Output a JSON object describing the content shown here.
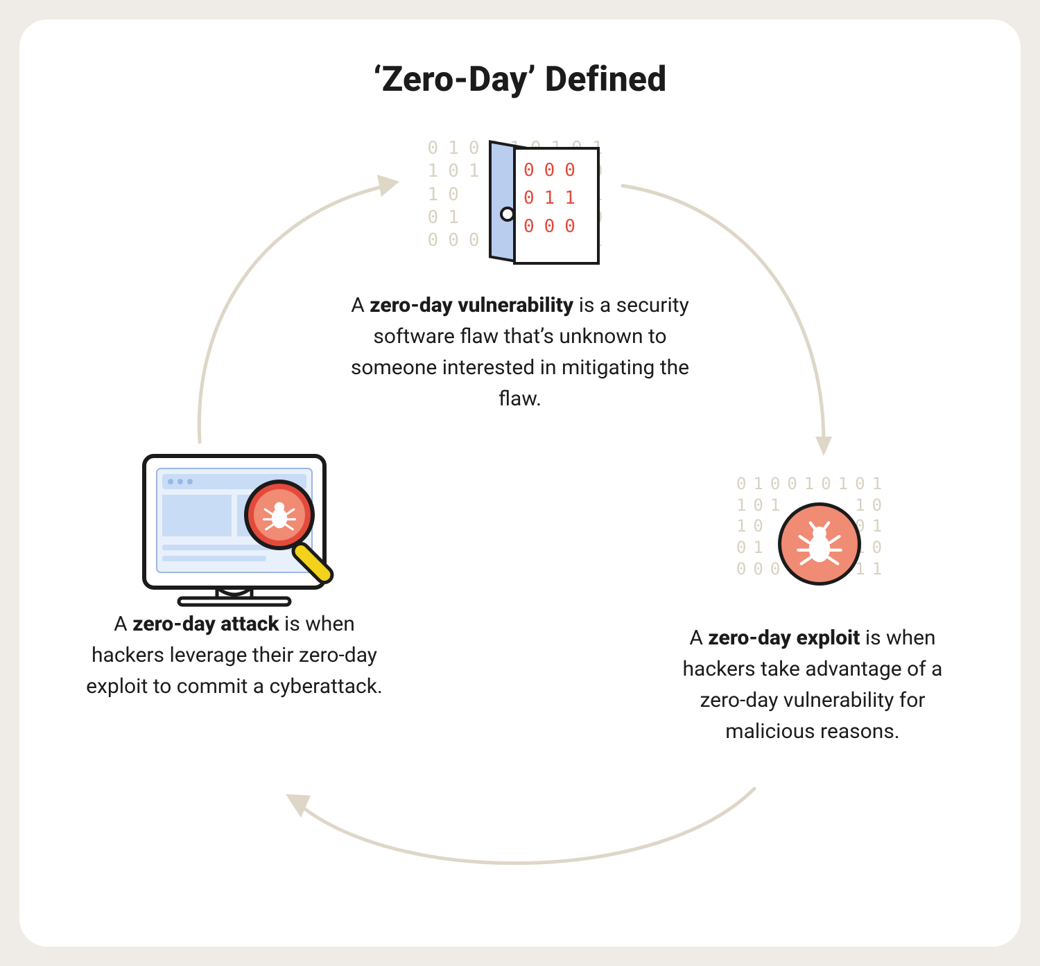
{
  "title": "‘Zero-Day’ Defined",
  "nodes": {
    "top": {
      "pre": "A ",
      "bold": "zero-day vulnerability",
      "post": " is a security software flaw that’s unknown to someone interested in mitigating the flaw."
    },
    "right": {
      "pre": "A ",
      "bold": "zero-day exploit",
      "post": " is when hackers take advantage of a zero-day vulnerability for malicious reasons."
    },
    "left": {
      "pre": "A ",
      "bold": "zero-day attack",
      "post": " is when hackers leverage their zero-day exploit to commit a cyberattack."
    }
  },
  "binary": {
    "grid": "010010101\n101    10\n10     01\n01     10\n000111011",
    "door_red": "000\n011\n000"
  },
  "icons": {
    "top": "door-binary-icon",
    "right": "bug-circle-icon",
    "left": "computer-bug-icon"
  },
  "colors": {
    "accent_coral": "#f08b74",
    "accent_red": "#e44a3c",
    "accent_blue": "#b9cdef",
    "accent_yellow": "#f2d21a",
    "arrow": "#ded7c8"
  }
}
